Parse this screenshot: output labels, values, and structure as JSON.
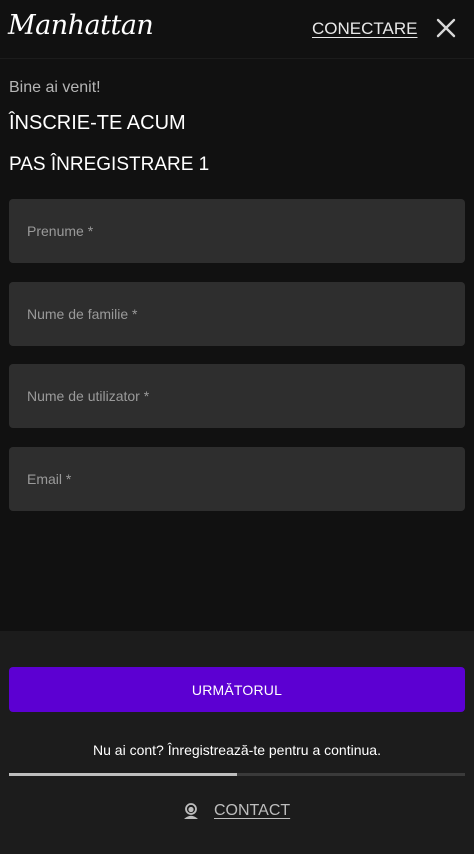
{
  "header": {
    "logo_text": "Manhattan",
    "login_label": "CONECTARE",
    "close_icon": "close-icon"
  },
  "form": {
    "welcome": "Bine ai venit!",
    "title": "ÎNSCRIE-TE ACUM",
    "step": "PAS ÎNREGISTRARE 1",
    "fields": [
      {
        "placeholder": "Prenume *",
        "value": ""
      },
      {
        "placeholder": "Nume de familie *",
        "value": ""
      },
      {
        "placeholder": "Nume de utilizator *",
        "value": ""
      },
      {
        "placeholder": "Email *",
        "value": ""
      }
    ]
  },
  "footer": {
    "next_label": "URMĂTORUL",
    "account_note": "Nu ai cont? Înregistrează-te pentru a continua.",
    "progress_fraction": 0.5,
    "contact_label": "CONTACT",
    "contact_icon": "support-agent-icon"
  },
  "colors": {
    "background": "#111111",
    "footer_background": "#1c1c1c",
    "field_background": "#2e2e2e",
    "primary_button": "#5c00d2"
  }
}
